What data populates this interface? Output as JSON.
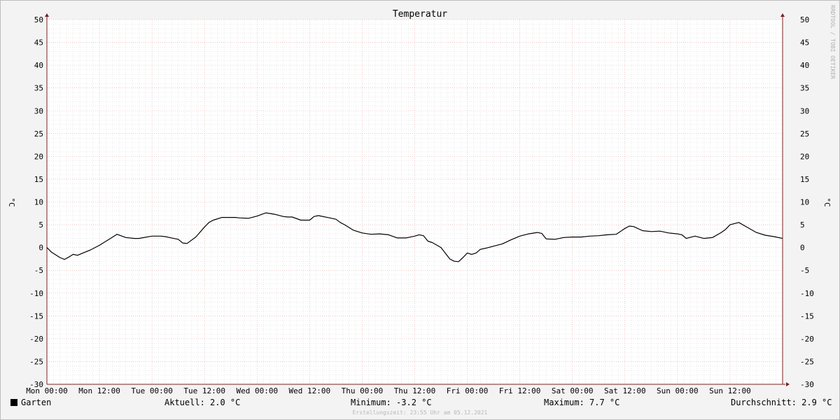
{
  "chart_data": {
    "type": "line",
    "title": "Temperatur",
    "ylabel": "°C",
    "ylabel_right": "°C",
    "ylim": [
      -30,
      50
    ],
    "yticks": [
      50,
      45,
      40,
      35,
      30,
      25,
      20,
      15,
      10,
      5,
      0,
      -5,
      -10,
      -15,
      -20,
      -25,
      -30
    ],
    "xlim": [
      0,
      168
    ],
    "xticks": [
      {
        "x": 0,
        "label": "Mon 00:00"
      },
      {
        "x": 12,
        "label": "Mon 12:00"
      },
      {
        "x": 24,
        "label": "Tue 00:00"
      },
      {
        "x": 36,
        "label": "Tue 12:00"
      },
      {
        "x": 48,
        "label": "Wed 00:00"
      },
      {
        "x": 60,
        "label": "Wed 12:00"
      },
      {
        "x": 72,
        "label": "Thu 00:00"
      },
      {
        "x": 84,
        "label": "Thu 12:00"
      },
      {
        "x": 96,
        "label": "Fri 00:00"
      },
      {
        "x": 108,
        "label": "Fri 12:00"
      },
      {
        "x": 120,
        "label": "Sat 00:00"
      },
      {
        "x": 132,
        "label": "Sat 12:00"
      },
      {
        "x": 144,
        "label": "Sun 00:00"
      },
      {
        "x": 156,
        "label": "Sun 12:00"
      }
    ],
    "x_unit": "hours since Mon 00:00",
    "grid": true,
    "series": [
      {
        "name": "Garten",
        "color": "#000000",
        "x": [
          0,
          1,
          3,
          4,
          5,
          6,
          7,
          8,
          10,
          12,
          14,
          16,
          18,
          20,
          21,
          24,
          25,
          26,
          27,
          28,
          30,
          31,
          32,
          34,
          36,
          37,
          38,
          40,
          42,
          43,
          44,
          46,
          48,
          50,
          52,
          54,
          55,
          56,
          58,
          60,
          61,
          62,
          64,
          66,
          67,
          68,
          70,
          72,
          74,
          76,
          78,
          80,
          82,
          84,
          85,
          86,
          87,
          88,
          90,
          92,
          93,
          94,
          95,
          96,
          97,
          98,
          99,
          100,
          102,
          104,
          106,
          108,
          110,
          112,
          113,
          114,
          116,
          118,
          120,
          122,
          124,
          126,
          128,
          130,
          132,
          133,
          134,
          136,
          138,
          140,
          142,
          144,
          145,
          146,
          148,
          150,
          152,
          154,
          155,
          156,
          158,
          160,
          162,
          164,
          166,
          168
        ],
        "values": [
          0,
          -1,
          -2.2,
          -2.6,
          -2.1,
          -1.5,
          -1.7,
          -1.3,
          -0.5,
          0.5,
          1.7,
          2.9,
          2.2,
          2.0,
          2.0,
          2.5,
          2.5,
          2.5,
          2.4,
          2.2,
          1.8,
          1.0,
          0.9,
          2.3,
          4.5,
          5.5,
          6.0,
          6.6,
          6.6,
          6.6,
          6.5,
          6.4,
          6.9,
          7.6,
          7.3,
          6.8,
          6.7,
          6.7,
          6.0,
          6.0,
          6.8,
          7.0,
          6.6,
          6.2,
          5.5,
          5.0,
          3.8,
          3.2,
          2.9,
          3.0,
          2.8,
          2.1,
          2.1,
          2.5,
          2.8,
          2.6,
          1.4,
          1.1,
          0.0,
          -2.5,
          -3.0,
          -3.1,
          -2.2,
          -1.2,
          -1.5,
          -1.2,
          -0.4,
          -0.2,
          0.3,
          0.8,
          1.7,
          2.5,
          3.0,
          3.3,
          3.1,
          1.9,
          1.8,
          2.2,
          2.3,
          2.3,
          2.5,
          2.6,
          2.8,
          2.9,
          4.2,
          4.7,
          4.6,
          3.7,
          3.5,
          3.6,
          3.2,
          3.0,
          2.8,
          2.0,
          2.5,
          2.0,
          2.2,
          3.3,
          4.0,
          5.0,
          5.5,
          4.4,
          3.3,
          2.7,
          2.4,
          2.0
        ]
      }
    ],
    "annotations": [
      "RRDTOOL / TOBI OETIKER"
    ],
    "stats": {
      "Aktuell": "2.0 °C",
      "Minimum": "-3.2 °C",
      "Maximum": "7.7 °C",
      "Durchschnitt": "2.9 °C"
    },
    "footer": "Erstellungszeit: 23:55 Uhr am 05.12.2021"
  },
  "legend": {
    "series_name": "Garten",
    "aktuell": "Aktuell: 2.0 °C",
    "minimum": "Minimum: -3.2 °C",
    "maximum": "Maximum: 7.7 °C",
    "durchschnitt": "Durchschnitt: 2.9 °C"
  },
  "colors": {
    "background": "#f3f3f3",
    "plot_background": "#ffffff",
    "major_grid": "#e0a0a0",
    "minor_grid": "#d4d4d4",
    "axis": "#7a2020",
    "line": "#000000"
  }
}
